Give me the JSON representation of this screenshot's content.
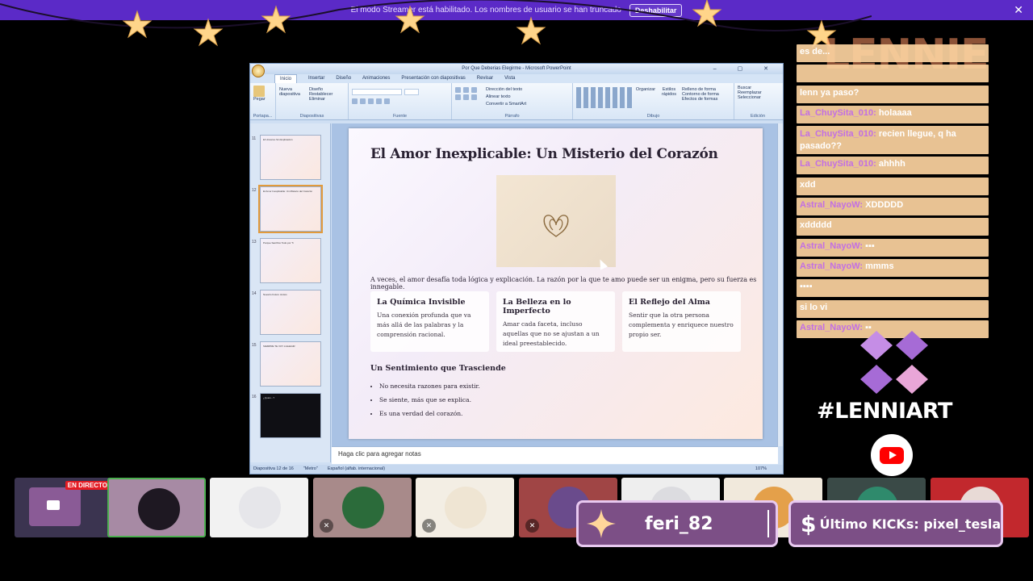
{
  "banner": {
    "text": "El modo Streamer está habilitado. Los nombres de usuario se han truncado",
    "button_label": "Deshabilitar",
    "close_symbol": "✕"
  },
  "ppt": {
    "window_title": "Por Que Deberias Elegirme - Microsoft PowerPoint",
    "window_controls": "–  ▢  ✕",
    "tabs": [
      "Inicio",
      "Insertar",
      "Diseño",
      "Animaciones",
      "Presentación con diapositivas",
      "Revisar",
      "Vista"
    ],
    "ribbon_groups": {
      "portapapeles": "Portapa...",
      "paste_label": "Pegar",
      "diapositivas": "Diapositivas",
      "new_slide": "Nueva diapositiva",
      "layout": "Diseño",
      "reset": "Restablecer",
      "delete": "Eliminar",
      "fuente": "Fuente",
      "parrafo": "Párrafo",
      "text_direction": "Dirección del texto",
      "align_text": "Alinear texto",
      "convert_smartart": "Convertir a SmartArt",
      "dibujo": "Dibujo",
      "organize": "Organizar",
      "quick_styles": "Estilos rápidos",
      "shape_fill": "Relleno de forma",
      "shape_outline": "Contorno de forma",
      "shape_effects": "Efectos de formas",
      "edicion": "Edición",
      "find": "Buscar",
      "replace": "Reemplazar",
      "select": "Seleccionar"
    },
    "thumbnails": [
      {
        "num": "11",
        "text": "El Universo Sin Explicación"
      },
      {
        "num": "12",
        "text": "El Amor Inexplicable: Un Misterio del Corazón"
      },
      {
        "num": "13",
        "text": "Porque Sacrifico Todo por Ti"
      },
      {
        "num": "14",
        "text": "Nuestro Futuro Juntos"
      },
      {
        "num": "15",
        "text": "SIEMPRE TE VOY A ELEGIR"
      },
      {
        "num": "16",
        "text": "¿Quién...?"
      }
    ],
    "slide": {
      "title": "El Amor Inexplicable: Un Misterio del Corazón",
      "intro": "A veces, el amor desafía toda lógica y explicación. La razón por la que te amo puede ser un enigma, pero su fuerza es innegable.",
      "cards": [
        {
          "heading": "La Química Invisible",
          "body": "Una conexión profunda que va más allá de las palabras y la comprensión racional."
        },
        {
          "heading": "La Belleza en lo Imperfecto",
          "body": "Amar cada faceta, incluso aquellas que no se ajustan a un ideal preestablecido."
        },
        {
          "heading": "El Reflejo del Alma",
          "body": "Sentir que la otra persona complementa y enriquece nuestro propio ser."
        }
      ],
      "subheading": "Un Sentimiento que Trasciende",
      "bullets": [
        "No necesita razones para existir.",
        "Se siente, más que se explica.",
        "Es una verdad del corazón."
      ]
    },
    "notes_placeholder": "Haga clic para agregar notas",
    "status": {
      "slide_counter": "Diapositiva 12 de 16",
      "theme": "\"Metro\"",
      "language": "Español (alfab. internacional)",
      "zoom": "107%"
    }
  },
  "chat": {
    "messages": [
      {
        "user": "",
        "text": "es de..."
      },
      {
        "user": "",
        "text": ""
      },
      {
        "user": "",
        "text": "lenn ya paso?"
      },
      {
        "user": "La_ChuySita_010:",
        "text": "holaaaa"
      },
      {
        "user": "La_ChuySita_010:",
        "text": "recien llegue, q ha pasado??"
      },
      {
        "user": "La_ChuySita_010:",
        "text": "ahhhh"
      },
      {
        "user": "",
        "text": "xdd"
      },
      {
        "user": "Astral_NayoW:",
        "text": "XDDDDD"
      },
      {
        "user": "",
        "text": "xddddd"
      },
      {
        "user": "Astral_NayoW:",
        "text": "▪▪▪"
      },
      {
        "user": "Astral_NayoW:",
        "text": "mmms"
      },
      {
        "user": "",
        "text": "▪▪▪▪"
      },
      {
        "user": "",
        "text": "si lo vi"
      },
      {
        "user": "Astral_NayoW:",
        "text": "▪▪"
      }
    ]
  },
  "brand": {
    "name": "LENNIE",
    "hashtag": "#LENNIART"
  },
  "tiles": {
    "live_badge": "EN DIRECTO"
  },
  "overlays": {
    "follower": "feri_82",
    "kicks": "Último KICKs: pixel_tesla"
  },
  "colors": {
    "banner": "#5b2ac7",
    "chat_bg": "#fcd2a0",
    "chat_user": "#c26fe4",
    "live": "#e41b23",
    "pill": "#7c4f86"
  }
}
